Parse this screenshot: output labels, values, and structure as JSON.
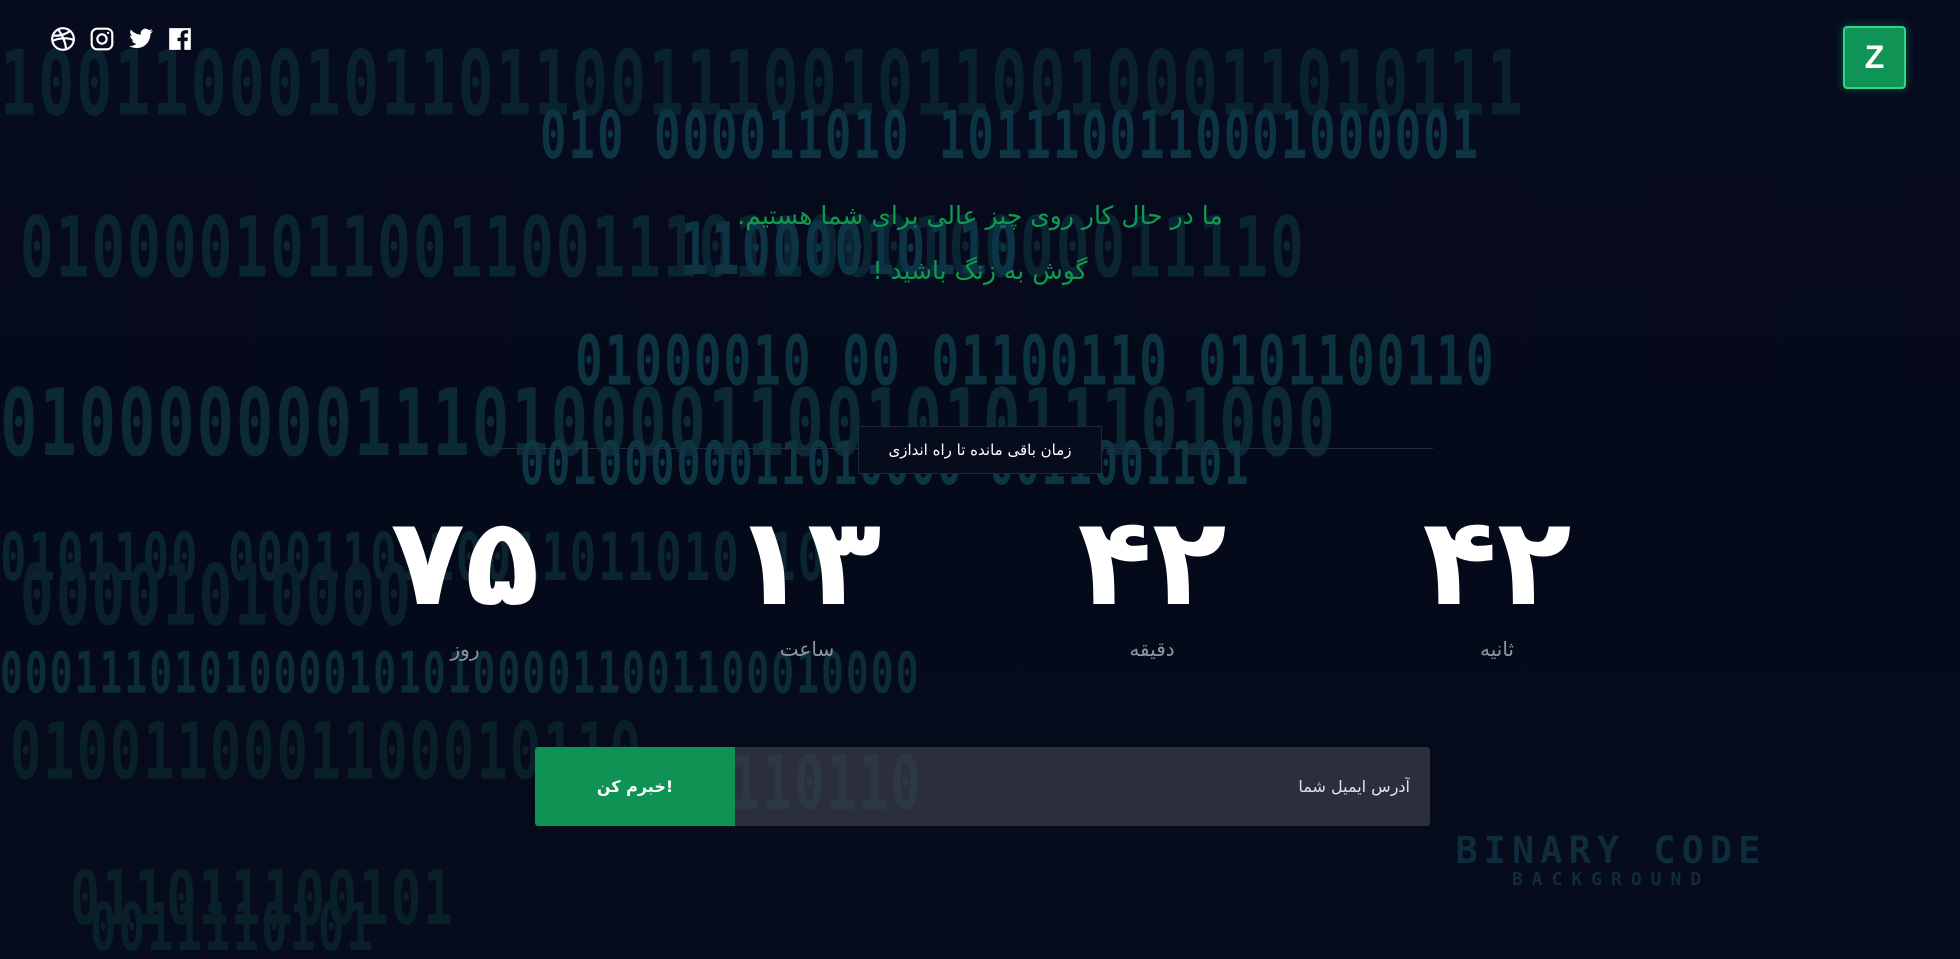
{
  "social": {
    "icons": [
      "dribbble-icon",
      "instagram-icon",
      "twitter-icon",
      "facebook-icon"
    ]
  },
  "logo": {
    "letter": "Z"
  },
  "headline": {
    "line1": "ما در حال کار روی چیز عالی برای شما هستیم.",
    "line2": "گوش به زنگ باشید !"
  },
  "countdown": {
    "label": "زمان باقی مانده تا راه اندازی",
    "days": {
      "value": "۷۵",
      "label": "روز"
    },
    "hours": {
      "value": "۱۳",
      "label": "ساعت"
    },
    "minutes": {
      "value": "۴۲",
      "label": "دقیقه"
    },
    "seconds": {
      "value": "۴۲",
      "label": "ثانیه"
    }
  },
  "subscribe": {
    "placeholder": "آدرس ایمیل شما",
    "button_label": "خبرم کن!"
  },
  "background": {
    "watermark_title": "BINARY CODE",
    "watermark_subtitle": "BACKGROUND"
  },
  "colors": {
    "background": "#050a1c",
    "accent_green": "#0f9354",
    "headline_green": "#0f9a4f",
    "binary_teal": "#0c3a48",
    "input_gray": "#363a44"
  }
}
